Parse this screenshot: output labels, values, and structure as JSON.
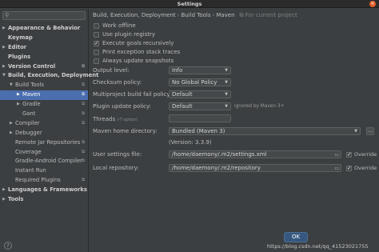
{
  "window": {
    "title": "Settings",
    "close_icon": "close-icon",
    "close_glyph": "×"
  },
  "sidebar": {
    "search_placeholder": "",
    "search_icon": "search-icon",
    "items": [
      {
        "label": "Appearance & Behavior",
        "bold": true,
        "expanded": false,
        "depth": 0,
        "cfg": false
      },
      {
        "label": "Keymap",
        "bold": true,
        "expanded": null,
        "depth": 0,
        "cfg": false
      },
      {
        "label": "Editor",
        "bold": true,
        "expanded": false,
        "depth": 0,
        "cfg": false
      },
      {
        "label": "Plugins",
        "bold": true,
        "expanded": null,
        "depth": 0,
        "cfg": false
      },
      {
        "label": "Version Control",
        "bold": true,
        "expanded": false,
        "depth": 0,
        "cfg": true
      },
      {
        "label": "Build, Execution, Deployment",
        "bold": true,
        "expanded": true,
        "depth": 0,
        "cfg": false
      },
      {
        "label": "Build Tools",
        "bold": false,
        "expanded": true,
        "depth": 1,
        "cfg": true
      },
      {
        "label": "Maven",
        "bold": false,
        "expanded": false,
        "depth": 2,
        "cfg": true,
        "selected": true
      },
      {
        "label": "Gradle",
        "bold": false,
        "expanded": false,
        "depth": 2,
        "cfg": true
      },
      {
        "label": "Gant",
        "bold": false,
        "expanded": null,
        "depth": 2,
        "cfg": true
      },
      {
        "label": "Compiler",
        "bold": false,
        "expanded": false,
        "depth": 1,
        "cfg": true
      },
      {
        "label": "Debugger",
        "bold": false,
        "expanded": false,
        "depth": 1,
        "cfg": false
      },
      {
        "label": "Remote Jar Repositories",
        "bold": false,
        "expanded": null,
        "depth": 1,
        "cfg": true
      },
      {
        "label": "Coverage",
        "bold": false,
        "expanded": null,
        "depth": 1,
        "cfg": true
      },
      {
        "label": "Gradle-Android Compiler",
        "bold": false,
        "expanded": null,
        "depth": 1,
        "cfg": true
      },
      {
        "label": "Instant Run",
        "bold": false,
        "expanded": null,
        "depth": 1,
        "cfg": false
      },
      {
        "label": "Required Plugins",
        "bold": false,
        "expanded": null,
        "depth": 1,
        "cfg": true
      },
      {
        "label": "Languages & Frameworks",
        "bold": true,
        "expanded": false,
        "depth": 0,
        "cfg": false
      },
      {
        "label": "Tools",
        "bold": true,
        "expanded": false,
        "depth": 0,
        "cfg": false
      }
    ],
    "help_glyph": "?"
  },
  "breadcrumb": {
    "parts": [
      "Build, Execution, Deployment",
      "Build Tools",
      "Maven"
    ],
    "separator": "›",
    "project_note": "For current project",
    "project_icon": "copy-icon"
  },
  "checkboxes": [
    {
      "label": "Work offline",
      "checked": false
    },
    {
      "label": "Use plugin registry",
      "checked": false
    },
    {
      "label": "Execute goals recursively",
      "checked": true
    },
    {
      "label": "Print exception stack traces",
      "checked": false
    },
    {
      "label": "Always update snapshots",
      "checked": false
    }
  ],
  "fields": {
    "output_level": {
      "label": "Output level:",
      "value": "Info"
    },
    "checksum_policy": {
      "label": "Checksum policy:",
      "value": "No Global Policy"
    },
    "multiproject_fail_policy": {
      "label": "Multiproject build fail policy:",
      "value": "Default"
    },
    "plugin_update_policy": {
      "label": "Plugin update policy:",
      "value": "Default",
      "note": "ignored by Maven 3+"
    },
    "threads": {
      "label": "Threads",
      "hint": "(-T option)",
      "value": ""
    },
    "maven_home": {
      "label": "Maven home directory:",
      "value": "Bundled (Maven 3)",
      "version": "(Version: 3.3.9)",
      "browse": "..."
    },
    "user_settings": {
      "label": "User settings file:",
      "value": "/home/daemony/.m2/settings.xml",
      "override_label": "Override",
      "override": true
    },
    "local_repo": {
      "label": "Local repository:",
      "value": "/home/daemony/.m2/repository",
      "override_label": "Override",
      "override": true
    }
  },
  "footer": {
    "ok_label": "OK",
    "watermark": "https://blog.csdn.net/qq_41523021755"
  }
}
